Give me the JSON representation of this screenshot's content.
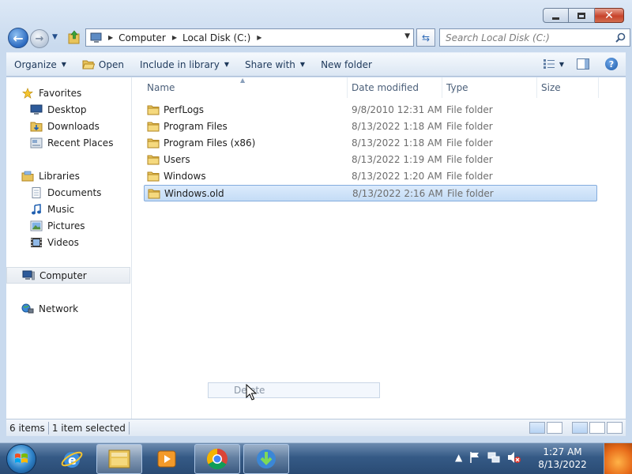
{
  "window": {
    "controls": {
      "minimize": "minimize",
      "maximize": "maximize",
      "close": "close"
    }
  },
  "address_bar": {
    "crumbs": [
      "Computer",
      "Local Disk (C:)"
    ],
    "search_placeholder": "Search Local Disk (C:)"
  },
  "command_bar": {
    "organize": "Organize",
    "open": "Open",
    "include_in_library": "Include in library",
    "share_with": "Share with",
    "new_folder": "New folder"
  },
  "nav_pane": {
    "favorites": {
      "label": "Favorites",
      "items": [
        "Desktop",
        "Downloads",
        "Recent Places"
      ]
    },
    "libraries": {
      "label": "Libraries",
      "items": [
        "Documents",
        "Music",
        "Pictures",
        "Videos"
      ]
    },
    "computer": "Computer",
    "network": "Network"
  },
  "file_list": {
    "columns": [
      "Name",
      "Date modified",
      "Type",
      "Size"
    ],
    "rows": [
      {
        "name": "PerfLogs",
        "date": "9/8/2010 12:31 AM",
        "type": "File folder",
        "selected": false
      },
      {
        "name": "Program Files",
        "date": "8/13/2022 1:18 AM",
        "type": "File folder",
        "selected": false
      },
      {
        "name": "Program Files (x86)",
        "date": "8/13/2022 1:18 AM",
        "type": "File folder",
        "selected": false
      },
      {
        "name": "Users",
        "date": "8/13/2022 1:19 AM",
        "type": "File folder",
        "selected": false
      },
      {
        "name": "Windows",
        "date": "8/13/2022 1:20 AM",
        "type": "File folder",
        "selected": false
      },
      {
        "name": "Windows.old",
        "date": "8/13/2022 2:16 AM",
        "type": "File folder",
        "selected": true
      }
    ],
    "drag_ghost": "Delete"
  },
  "status_bar": {
    "items_count": "6 items",
    "selection": "1 item selected"
  },
  "taskbar": {
    "time": "1:27 AM",
    "date": "8/13/2022",
    "pinned": [
      "internet-explorer",
      "windows-explorer",
      "windows-media-player",
      "google-chrome",
      "internet-download-manager"
    ]
  },
  "colors": {
    "accent": "#2c6ac0",
    "selection": "#c4dcf6",
    "taskbar": "#355a86"
  }
}
